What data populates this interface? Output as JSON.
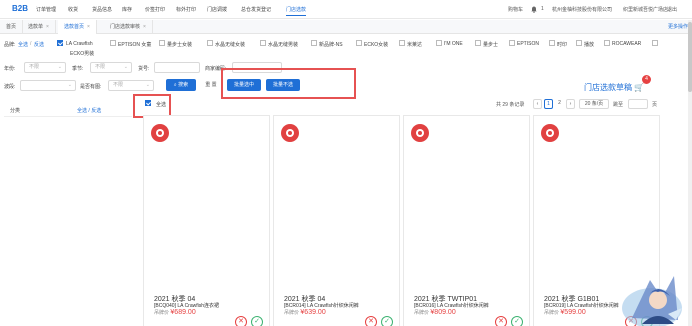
{
  "logo": "B2B",
  "nav": [
    "订单管理",
    "收货",
    "货品信息",
    "库存",
    "价签打印",
    "标外打印",
    "门店调拨",
    "总仓发货登记",
    "门店选款"
  ],
  "topright": {
    "cart": "购物车",
    "bell_icon": "bell-icon",
    "bell_count": "1",
    "company": "杭州金柚科技股份有限公司",
    "store": "织里新城吾悦广场店",
    "logout": "退出"
  },
  "tabs": [
    {
      "label": "首页"
    },
    {
      "label": "选款单",
      "close": "×"
    },
    {
      "label": "选款首页",
      "close": "×"
    },
    {
      "label": "门店选款审核",
      "close": "×"
    }
  ],
  "tab_more": "更多操作",
  "brand": {
    "label": "品牌:",
    "select_all": "全选",
    "invert": "反选",
    "items": [
      {
        "name": "LA Crawfish",
        "checked": true
      },
      {
        "name": "EPTISON 女童",
        "checked": false
      },
      {
        "name": "量步士女装",
        "checked": false
      },
      {
        "name": "水晶无缝女装",
        "checked": false
      },
      {
        "name": "水晶无缝男装",
        "checked": false
      },
      {
        "name": "新品牌-NS",
        "checked": false
      },
      {
        "name": "ECKO女装",
        "checked": false
      },
      {
        "name": "米莱达",
        "checked": false
      },
      {
        "name": "I'M ONE",
        "checked": false
      },
      {
        "name": "量步士",
        "checked": false
      },
      {
        "name": "EPTISON",
        "checked": false
      },
      {
        "name": "时印",
        "checked": false
      },
      {
        "name": "播放",
        "checked": false
      },
      {
        "name": "ROCAWEAR",
        "checked": false
      },
      {
        "name": "ECKO男装",
        "checked": false
      }
    ]
  },
  "filters": {
    "year_label": "年份:",
    "year_placeholder": "不限",
    "season_label": "季节:",
    "season_placeholder": "不限",
    "sku_label": "货号:",
    "goods_label": "商家编码:",
    "wave_label": "波段:",
    "has_image_label": "是否有图:",
    "has_image_placeholder": "不限",
    "search_btn": "搜索",
    "reset_btn": "重 置",
    "batch_select_btn": "批量选中",
    "batch_unselect_btn": "批量不选"
  },
  "cart_link": "门店选款草稿",
  "cart_badge": "4",
  "select_all_label": "全选",
  "sidebar": {
    "title": "分类",
    "select_all": "全选",
    "invert": "反选"
  },
  "pager": {
    "total": "共 29 条记录",
    "pages": [
      "1",
      "2"
    ],
    "current": "1",
    "per_page": "20 条/页",
    "goto": "跳至",
    "page_unit": "页"
  },
  "products": [
    {
      "season": "2021 秋季 04",
      "desc": "[BCQ040] LA Crawfish连衣裙",
      "price_label": "吊牌价",
      "price": "¥689.00"
    },
    {
      "season": "2021 秋季 04",
      "desc": "[BCR014] LA Crawfish针织休闲裤",
      "price_label": "吊牌价",
      "price": "¥639.00"
    },
    {
      "season": "2021 秋季 TWTIP01",
      "desc": "[BCR016] LA Crawfish针织休闲裤",
      "price_label": "吊牌价",
      "price": "¥809.00"
    },
    {
      "season": "2021 秋季 G1B01",
      "desc": "[BCR019] LA Crawfish针织休闲裤",
      "price_label": "吊牌价",
      "price": "¥599.00"
    }
  ],
  "colors": {
    "primary": "#1f6fd6",
    "danger": "#e64242",
    "success": "#3cb371",
    "highlight": "#e65252"
  }
}
